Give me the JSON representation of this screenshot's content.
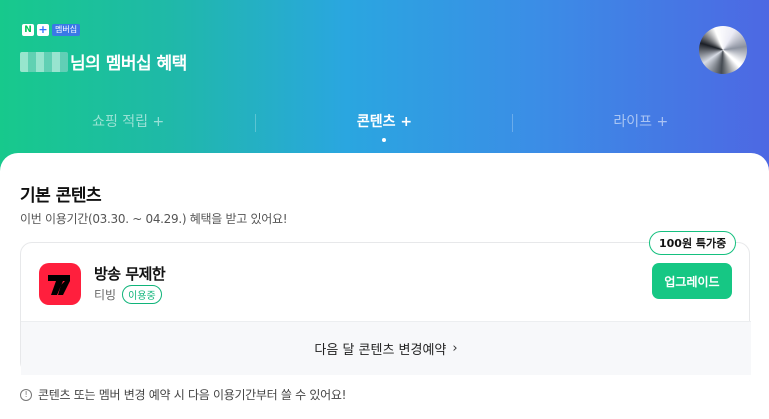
{
  "header": {
    "badge_n": "N",
    "badge_plus": "+",
    "badge_label": "멤버십",
    "title_suffix": "님의 멤버십 혜택"
  },
  "tabs": [
    {
      "label": "쇼핑 적립 +",
      "active": false
    },
    {
      "label": "콘텐츠 +",
      "active": true
    },
    {
      "label": "라이프 +",
      "active": false
    }
  ],
  "section": {
    "title": "기본 콘텐츠",
    "subtitle": "이번 이용기간(03.30. ~ 04.29.) 혜택을 받고 있어요!"
  },
  "service": {
    "name": "방송 무제한",
    "app": "티빙",
    "status": "이용중",
    "promo": "100원 특가중",
    "upgrade_label": "업그레이드"
  },
  "reserve": {
    "label": "다음 달 콘텐츠 변경예약",
    "chevron": "›"
  },
  "notice": {
    "icon": "!",
    "text": "콘텐츠 또는 멤버 변경 예약 시 다음 이용기간부터 쓸 수 있어요!"
  },
  "colors": {
    "accent_green": "#16c784",
    "tving_red": "#ff1f3d"
  }
}
